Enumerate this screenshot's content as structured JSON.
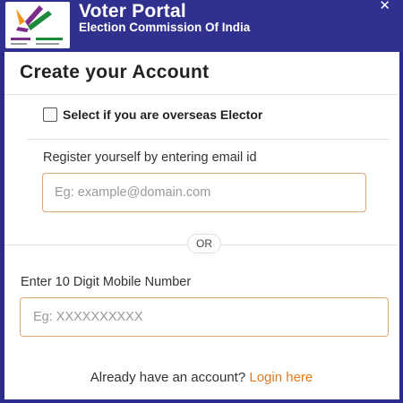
{
  "header": {
    "title": "Voter Portal",
    "subtitle": "Election Commission Of India",
    "close_glyph": "✕",
    "logo_icon": "eci-logo-icon",
    "logo_colors": [
      "#f7941d",
      "#7b2d8b",
      "#1b8a3a"
    ]
  },
  "page": {
    "title": "Create your Account"
  },
  "overseas": {
    "label": "Select if you are overseas Elector",
    "checked": false
  },
  "email": {
    "label": "Register yourself by entering email id",
    "placeholder": "Eg: example@domain.com",
    "value": ""
  },
  "separator": {
    "label": "OR"
  },
  "mobile": {
    "label": "Enter 10 Digit Mobile Number",
    "placeholder": "Eg: XXXXXXXXXX",
    "value": ""
  },
  "footer": {
    "prompt": "Already have an account?",
    "link_label": "Login here"
  },
  "colors": {
    "header_bg": "#30318f",
    "accent": "#e07b20",
    "input_border": "#e1a571"
  }
}
